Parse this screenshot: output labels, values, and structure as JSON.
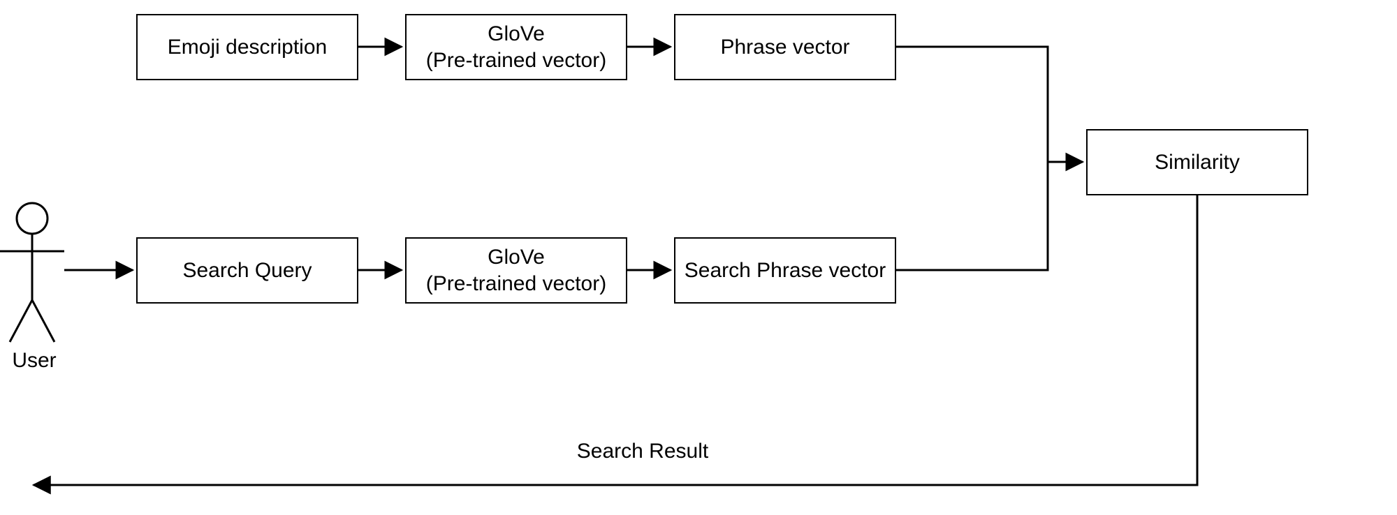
{
  "actor": {
    "label": "User"
  },
  "row1": {
    "box1": "Emoji description",
    "box2_line1": "GloVe",
    "box2_line2": "(Pre-trained vector)",
    "box3": "Phrase vector"
  },
  "row2": {
    "box1": "Search Query",
    "box2_line1": "GloVe",
    "box2_line2": "(Pre-trained vector)",
    "box3": "Search Phrase vector"
  },
  "similarity": "Similarity",
  "result_label": "Search Result"
}
